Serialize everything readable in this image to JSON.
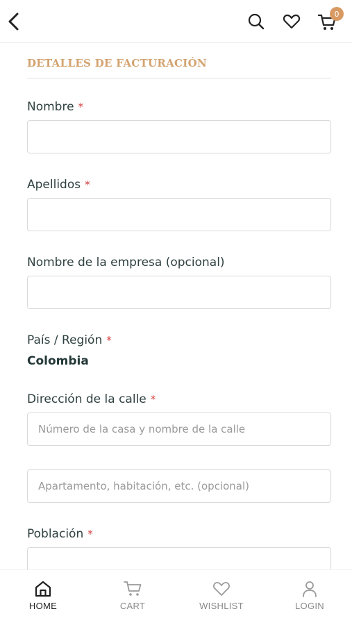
{
  "header": {
    "icons": [
      "chevron-left-icon",
      "search-icon",
      "heart-icon",
      "cart-icon"
    ],
    "cart_count": "0"
  },
  "form": {
    "section_title": "DETALLES DE FACTURACIÓN",
    "required_mark": "*",
    "fields": {
      "first_name": {
        "label": "Nombre",
        "value": ""
      },
      "last_name": {
        "label": "Apellidos",
        "value": ""
      },
      "company": {
        "label": "Nombre de la empresa (opcional)",
        "value": ""
      },
      "country": {
        "label": "País / Región",
        "value": "Colombia"
      },
      "street": {
        "label": "Dirección de la calle",
        "placeholder_1": "Número de la casa y nombre de la calle",
        "placeholder_2": "Apartamento, habitación, etc. (opcional)"
      },
      "city": {
        "label": "Población",
        "value": ""
      }
    }
  },
  "bottom_nav": {
    "items": [
      {
        "label": "HOME",
        "icon": "home-icon",
        "active": true
      },
      {
        "label": "CART",
        "icon": "cart-icon",
        "active": false
      },
      {
        "label": "WISHLIST",
        "icon": "heart-icon",
        "active": false
      },
      {
        "label": "LOGIN",
        "icon": "user-icon",
        "active": false
      }
    ]
  },
  "colors": {
    "accent": "#d3a26f",
    "badge": "#d89a62",
    "required": "#d33a3a",
    "text": "#2f4040"
  }
}
